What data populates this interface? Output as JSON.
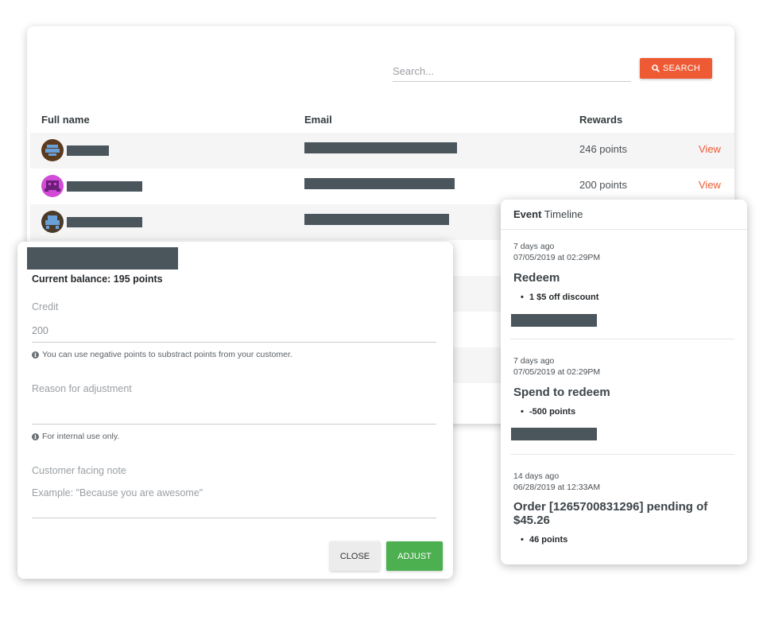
{
  "search": {
    "placeholder": "Search...",
    "button_label": "SEARCH",
    "icon": "search-icon"
  },
  "table": {
    "columns": [
      "Full name",
      "Email",
      "Rewards"
    ],
    "rows": [
      {
        "avatar_color": "#5b3a1e",
        "name": "",
        "email": "",
        "rewards": "246 points",
        "action": "View"
      },
      {
        "avatar_color": "#d14bd6",
        "name": "",
        "email": "",
        "rewards": "200 points",
        "action": "View"
      },
      {
        "avatar_color": "#4a3b2a",
        "name": "",
        "email": "",
        "rewards": "",
        "action": ""
      }
    ]
  },
  "adjust_modal": {
    "balance": "Current balance: 195 points",
    "credit_label": "Credit",
    "credit_value": "200",
    "credit_hint": "You can use negative points to substract points from your customer.",
    "reason_label": "Reason for adjustment",
    "reason_value": "",
    "reason_hint": "For internal use only.",
    "note_label": "Customer facing note",
    "note_placeholder": "Example: \"Because you are awesome\"",
    "close_label": "CLOSE",
    "adjust_label": "ADJUST"
  },
  "timeline": {
    "title_bold": "Event",
    "title_rest": " Timeline",
    "events": [
      {
        "ago": "7 days ago",
        "date": "07/05/2019 at 02:29PM",
        "title": "Redeem",
        "bullet": "1 $5 off discount"
      },
      {
        "ago": "7 days ago",
        "date": "07/05/2019 at 02:29PM",
        "title": "Spend to redeem",
        "bullet": "-500 points"
      },
      {
        "ago": "14 days ago",
        "date": "06/28/2019 at 12:33AM",
        "title": "Order [1265700831296] pending of $45.26",
        "bullet": "46 points"
      }
    ]
  },
  "colors": {
    "accent": "#ee5a34",
    "success": "#4caf50",
    "redaction": "#4a555c"
  }
}
